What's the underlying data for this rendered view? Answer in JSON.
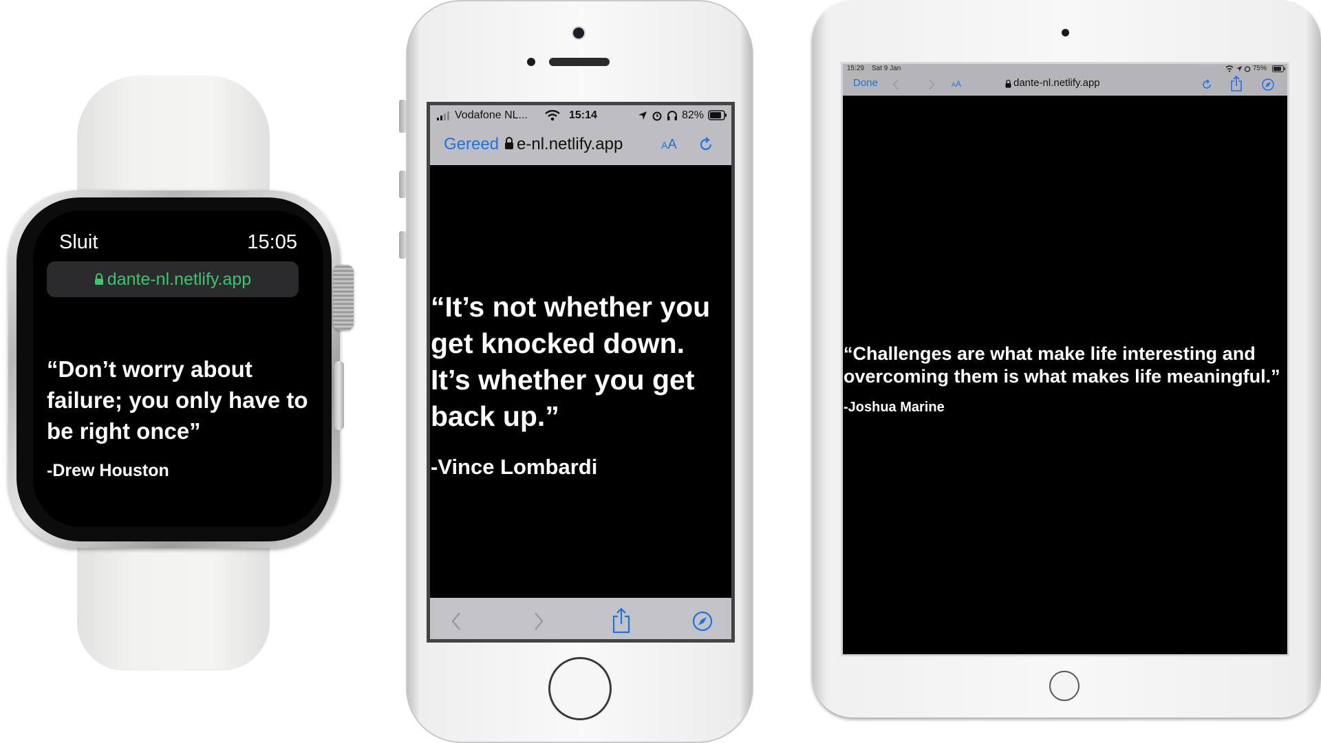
{
  "watch": {
    "close_label": "Sluit",
    "time": "15:05",
    "url": "dante-nl.netlify.app",
    "quote": "“Don’t worry about failure; you only have to be right once”",
    "author": "-Drew Houston",
    "url_color": "#37c867"
  },
  "phone": {
    "carrier": "Vodafone NL...",
    "time": "15:14",
    "battery": "82%",
    "done_label": "Gereed",
    "url": "e-nl.netlify.app",
    "text_size_label": "AA",
    "quote": "“It’s not whether you get knocked down. It’s whether you get back up.”",
    "author": "-Vince Lombardi",
    "accent": "#1a73e8"
  },
  "tablet": {
    "time": "15:29",
    "date": "Sat 9 Jan",
    "battery": "75%",
    "done_label": "Done",
    "text_size_label": "AA",
    "url": "dante-nl.netlify.app",
    "quote": "“Challenges are what make life interesting and overcoming them is what makes life meaningful.”",
    "author": "-Joshua Marine"
  }
}
